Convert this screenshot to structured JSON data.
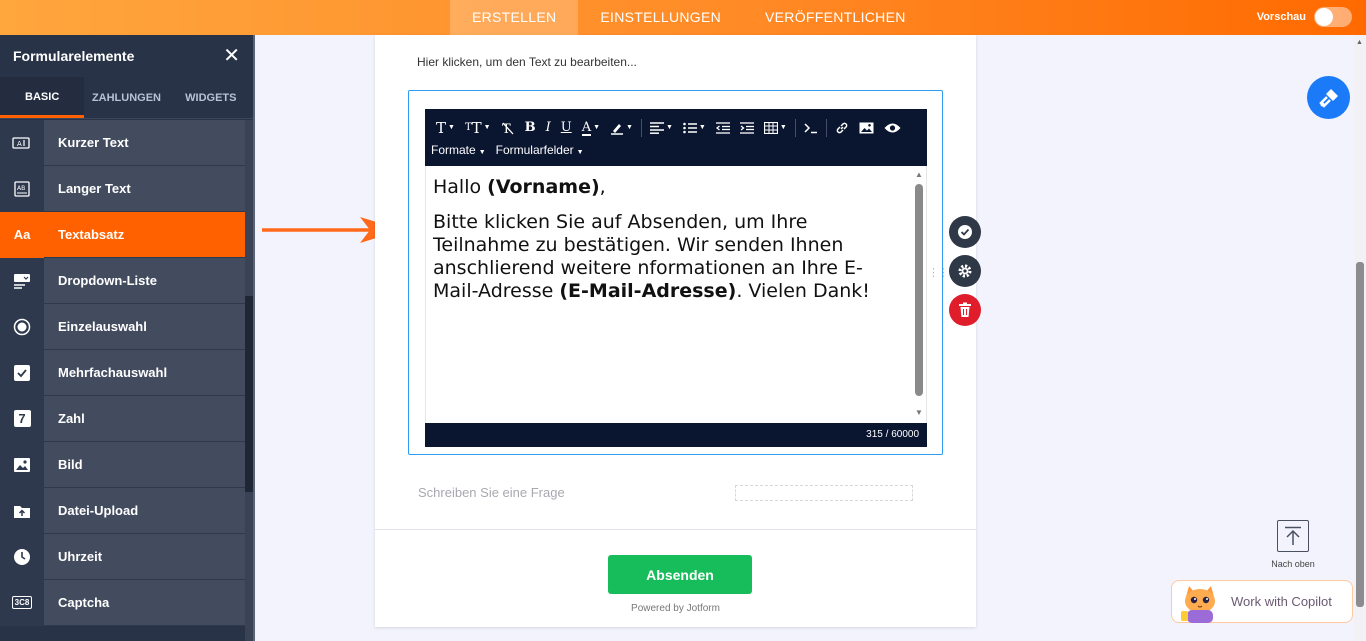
{
  "topbar": {
    "tabs": [
      {
        "label": "ERSTELLEN",
        "active": true
      },
      {
        "label": "EINSTELLUNGEN",
        "active": false
      },
      {
        "label": "VERÖFFENTLICHEN",
        "active": false
      }
    ],
    "preview_label": "Vorschau",
    "preview_enabled": false
  },
  "sidebar": {
    "title": "Formularelemente",
    "tabs": [
      {
        "label": "BASIC",
        "active": true
      },
      {
        "label": "ZAHLUNGEN",
        "active": false
      },
      {
        "label": "WIDGETS",
        "active": false
      }
    ],
    "items": [
      {
        "label": "Kurzer Text",
        "icon": "short-text-icon"
      },
      {
        "label": "Langer Text",
        "icon": "long-text-icon"
      },
      {
        "label": "Textabsatz",
        "icon": "paragraph-icon",
        "icon_text": "Aa",
        "active": true
      },
      {
        "label": "Dropdown-Liste",
        "icon": "dropdown-icon"
      },
      {
        "label": "Einzelauswahl",
        "icon": "radio-icon"
      },
      {
        "label": "Mehrfachauswahl",
        "icon": "checkbox-icon"
      },
      {
        "label": "Zahl",
        "icon": "number-icon",
        "icon_text": "7"
      },
      {
        "label": "Bild",
        "icon": "image-icon"
      },
      {
        "label": "Datei-Upload",
        "icon": "file-upload-icon"
      },
      {
        "label": "Uhrzeit",
        "icon": "clock-icon"
      },
      {
        "label": "Captcha",
        "icon": "captcha-icon",
        "icon_text": "3C8"
      }
    ]
  },
  "form": {
    "hint": "Hier klicken, um den Text zu bearbeiten...",
    "toolbar": {
      "formats_label": "Formate",
      "fields_label": "Formularfelder"
    },
    "editor": {
      "greeting_prefix": "Hallo ",
      "greeting_field": "(Vorname)",
      "greeting_suffix": ",",
      "body_prefix": "Bitte klicken Sie auf Absenden, um Ihre Teilnahme zu bestätigen. Wir senden Ihnen anschlierend weitere nformationen an Ihre E-Mail-Adresse ",
      "body_field": "(E-Mail-Adresse)",
      "body_suffix": ". Vielen Dank!",
      "char_count": "315 / 60000"
    },
    "question_placeholder": "Schreiben Sie eine Frage",
    "submit_label": "Absenden",
    "powered_by": "Powered by Jotform"
  },
  "right": {
    "to_top_label": "Nach oben",
    "copilot_label": "Work with Copilot"
  },
  "colors": {
    "accent_orange": "#ff6100",
    "sidebar_bg": "#293347",
    "editor_toolbar": "#0a1530",
    "submit_green": "#18bd5b",
    "delete_red": "#e01e2b",
    "fab_blue": "#1a7af8"
  }
}
